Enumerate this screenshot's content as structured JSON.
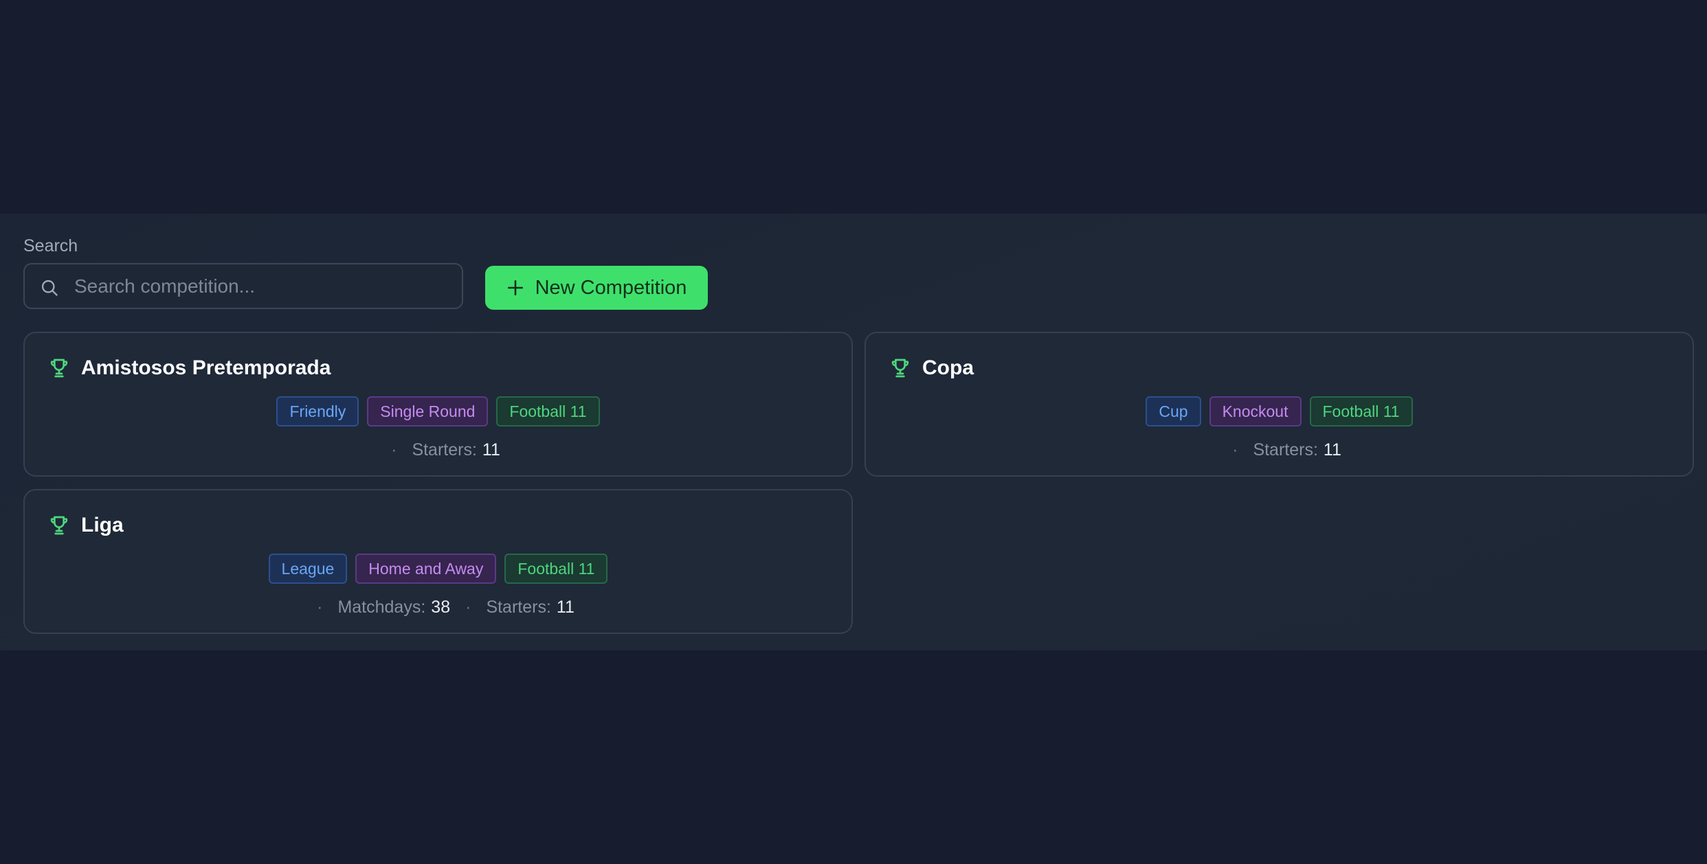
{
  "search": {
    "label": "Search",
    "placeholder": "Search competition...",
    "value": ""
  },
  "new_button": {
    "label": "New Competition"
  },
  "cards": [
    {
      "title": "Amistosos Pretemporada",
      "tags": [
        "Friendly",
        "Single Round",
        "Football 11"
      ],
      "meta": [
        {
          "label": "Starters:",
          "value": "11"
        }
      ]
    },
    {
      "title": "Copa",
      "tags": [
        "Cup",
        "Knockout",
        "Football 11"
      ],
      "meta": [
        {
          "label": "Starters:",
          "value": "11"
        }
      ]
    },
    {
      "title": "Liga",
      "tags": [
        "League",
        "Home and Away",
        "Football 11"
      ],
      "meta": [
        {
          "label": "Matchdays:",
          "value": "38"
        },
        {
          "label": "Starters:",
          "value": "11"
        }
      ]
    }
  ],
  "meta_separator": "·",
  "icons": {
    "search": "search-icon",
    "plus": "plus-icon",
    "trophy": "trophy-icon"
  },
  "colors": {
    "accent": "#3ee06b",
    "trophy": "#4fd57d",
    "tag_blue": "#6aa6f5",
    "tag_purple": "#c58bf0",
    "tag_green": "#4fd57d"
  }
}
